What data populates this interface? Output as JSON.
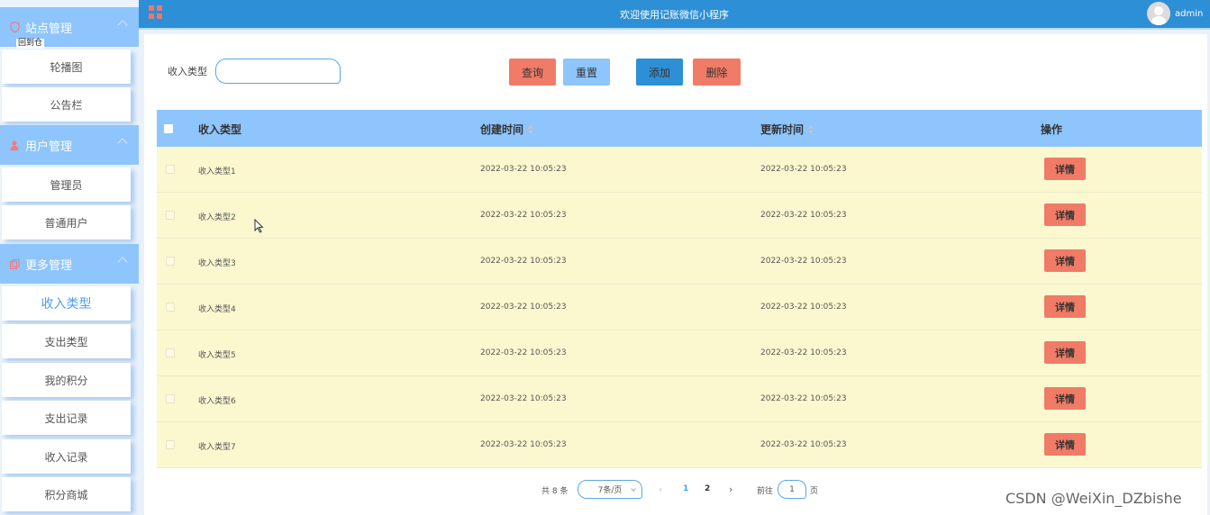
{
  "sidebar": {
    "tooltip": "回到仓",
    "groups": [
      {
        "label": "站点管理",
        "icon": "shield-icon"
      },
      {
        "label": "用户管理",
        "icon": "user-icon"
      },
      {
        "label": "更多管理",
        "icon": "copy-icon"
      }
    ],
    "items": [
      {
        "label": "轮播图"
      },
      {
        "label": "公告栏"
      },
      {
        "label": "管理员"
      },
      {
        "label": "普通用户"
      },
      {
        "label": "收入类型",
        "active": true
      },
      {
        "label": "支出类型"
      },
      {
        "label": "我的积分"
      },
      {
        "label": "支出记录"
      },
      {
        "label": "收入记录"
      },
      {
        "label": "积分商城"
      }
    ]
  },
  "header": {
    "title": "欢迎使用记账微信小程序",
    "username": "admin",
    "menu_icon": "grid-icon",
    "avatar_icon": "avatar-icon"
  },
  "search": {
    "label": "收入类型",
    "value": "",
    "placeholder": ""
  },
  "actions": {
    "query": "查询",
    "reset": "重置",
    "add": "添加",
    "delete": "删除"
  },
  "table": {
    "columns": [
      "收入类型",
      "创建时间",
      "更新时间",
      "操作"
    ],
    "detail_label": "详情",
    "rows": [
      {
        "name": "收入类型1",
        "created": "2022-03-22 10:05:23",
        "updated": "2022-03-22 10:05:23"
      },
      {
        "name": "收入类型2",
        "created": "2022-03-22 10:05:23",
        "updated": "2022-03-22 10:05:23"
      },
      {
        "name": "收入类型3",
        "created": "2022-03-22 10:05:23",
        "updated": "2022-03-22 10:05:23"
      },
      {
        "name": "收入类型4",
        "created": "2022-03-22 10:05:23",
        "updated": "2022-03-22 10:05:23"
      },
      {
        "name": "收入类型5",
        "created": "2022-03-22 10:05:23",
        "updated": "2022-03-22 10:05:23"
      },
      {
        "name": "收入类型6",
        "created": "2022-03-22 10:05:23",
        "updated": "2022-03-22 10:05:23"
      },
      {
        "name": "收入类型7",
        "created": "2022-03-22 10:05:23",
        "updated": "2022-03-22 10:05:23"
      }
    ]
  },
  "pagination": {
    "total": "共 8 条",
    "page_size": "7条/页",
    "prev": "‹",
    "next": "›",
    "pages": [
      "1",
      "2"
    ],
    "current": "1",
    "goto_label": "前往",
    "goto_value": "1",
    "page_suffix": "页"
  },
  "watermark": "CSDN @WeiXin_DZbishe",
  "colors": {
    "primary": "#2d8fd5",
    "light_blue": "#8ec5fc",
    "danger": "#f07b66",
    "row_bg": "#fbf8d0",
    "active_text": "#4ba0f0"
  }
}
